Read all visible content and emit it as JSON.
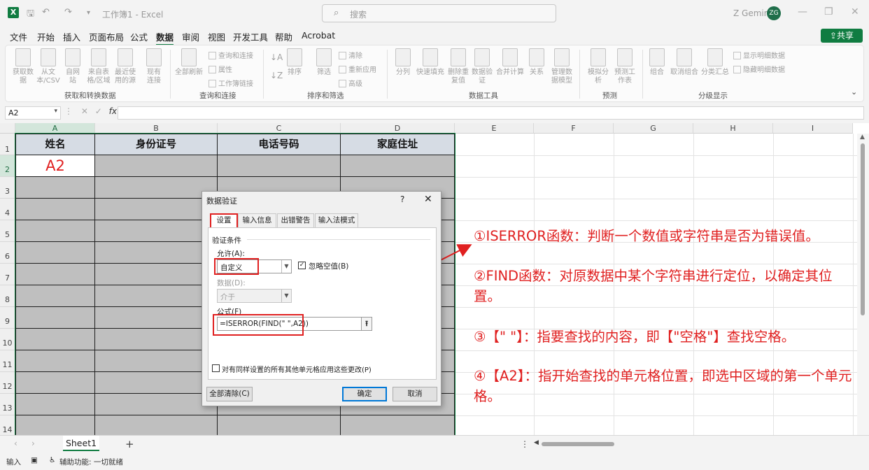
{
  "app": {
    "doc_title": "工作簿1 - Excel",
    "search_placeholder": "搜索",
    "user_name": "Z Gemini",
    "user_initials": "ZG",
    "logo_letter": "X",
    "share_label": "共享",
    "accent": "#107c41"
  },
  "menu": [
    "文件",
    "开始",
    "插入",
    "页面布局",
    "公式",
    "数据",
    "审阅",
    "视图",
    "开发工具",
    "帮助",
    "Acrobat"
  ],
  "menu_active": "数据",
  "ribbon": {
    "groups": [
      "获取和转换数据",
      "查询和连接",
      "排序和筛选",
      "数据工具",
      "预测",
      "分级显示"
    ],
    "buttons": {
      "get_data": "获取数据",
      "from_csv": "从文本/CSV",
      "from_web": "自网站",
      "from_table": "来自表格/区域",
      "recent_sources": "最近使用的源",
      "existing_conn": "现有连接",
      "refresh_all": "全部刷新",
      "queries": "查询和连接",
      "properties": "属性",
      "workbook_links": "工作簿链接",
      "sort": "排序",
      "filter": "筛选",
      "clear": "清除",
      "reapply": "重新应用",
      "advanced": "高级",
      "text_to_col": "分列",
      "flash_fill": "快速填充",
      "remove_dup": "删除重复值",
      "data_valid": "数据验证",
      "consolidate": "合并计算",
      "relations": "关系",
      "data_model": "管理数据模型",
      "what_if": "模拟分析",
      "forecast": "预测工作表",
      "group": "组合",
      "ungroup": "取消组合",
      "subtotal": "分类汇总",
      "show_detail": "显示明细数据",
      "hide_detail": "隐藏明细数据"
    }
  },
  "formula_bar": {
    "name_box": "A2",
    "fx": "fx",
    "value": ""
  },
  "grid": {
    "columns": [
      "A",
      "B",
      "C",
      "D",
      "E",
      "F",
      "G",
      "H",
      "I"
    ],
    "rows": [
      "1",
      "2",
      "3",
      "4",
      "5",
      "6",
      "7",
      "8",
      "9",
      "10",
      "11",
      "12",
      "13",
      "14"
    ],
    "headers": [
      "姓名",
      "身份证号",
      "电话号码",
      "家庭住址"
    ],
    "a2": "A2"
  },
  "annotations": [
    "①ISERROR函数：判断一个数值或字符串是否为错误值。",
    "②FIND函数：对原数据中某个字符串进行定位，以确定其位置。",
    "③【\" \"】：指要查找的内容，即【\"空格\"】查找空格。",
    "④【A2】：指开始查找的单元格位置，即选中区域的第一个单元格。"
  ],
  "dialog": {
    "title": "数据验证",
    "help": "?",
    "close": "✕",
    "tabs": [
      "设置",
      "输入信息",
      "出错警告",
      "输入法模式"
    ],
    "section": "验证条件",
    "allow_label": "允许(A):",
    "allow_value": "自定义",
    "ignore_blank": "忽略空值(B)",
    "data_label": "数据(D):",
    "data_value": "介于",
    "formula_label": "公式(F)",
    "formula_value": "=ISERROR(FIND(\" \",A2))",
    "apply_all": "对有同样设置的所有其他单元格应用这些更改(P)",
    "clear_all": "全部清除(C)",
    "ok": "确定",
    "cancel": "取消",
    "highlight_color": "#e02020"
  },
  "sheets": [
    "Sheet1"
  ],
  "status": {
    "mode": "输入",
    "accessibility": "辅助功能: 一切就绪"
  }
}
